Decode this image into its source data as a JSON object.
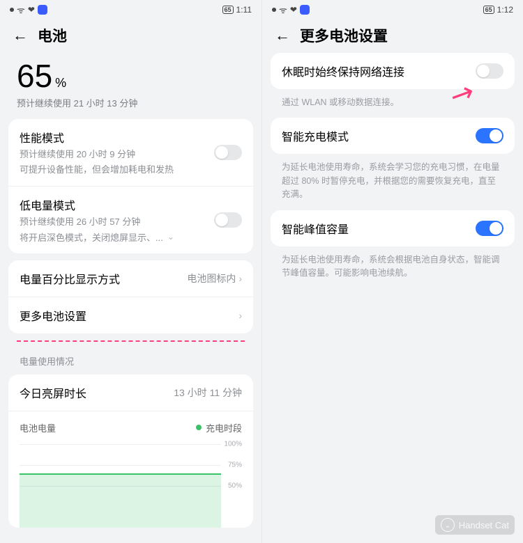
{
  "left": {
    "status": {
      "battery": "65",
      "time": "1:11"
    },
    "header": {
      "title": "电池"
    },
    "hero": {
      "percent": "65",
      "pct_symbol": "%",
      "subtitle": "预计继续使用 21 小时 13 分钟"
    },
    "modes": {
      "perf": {
        "title": "性能模式",
        "sub1": "预计继续使用 20 小时 9 分钟",
        "sub2": "可提升设备性能，但会增加耗电和发热",
        "on": false
      },
      "low": {
        "title": "低电量模式",
        "sub1": "预计继续使用 26 小时 57 分钟",
        "sub2": "将开启深色模式，关闭熄屏显示、...",
        "on": false
      }
    },
    "display": {
      "title": "电量百分比显示方式",
      "value": "电池图标内"
    },
    "more": {
      "title": "更多电池设置"
    },
    "usage_section": "电量使用情况",
    "screen": {
      "title": "今日亮屏时长",
      "value": "13 小时 11 分钟"
    },
    "chart": {
      "label": "电池电量",
      "legend": "充电时段",
      "yticks": [
        "100%",
        "75%",
        "50%"
      ]
    }
  },
  "right": {
    "status": {
      "battery": "65",
      "time": "1:12"
    },
    "header": {
      "title": "更多电池设置"
    },
    "sleep": {
      "title": "休眠时始终保持网络连接",
      "desc": "通过 WLAN 或移动数据连接。",
      "on": false
    },
    "smart_charge": {
      "title": "智能充电模式",
      "desc": "为延长电池使用寿命，系统会学习您的充电习惯，在电量超过 80% 时暂停充电，并根据您的需要恢复充电，直至充满。",
      "on": true
    },
    "smart_peak": {
      "title": "智能峰值容量",
      "desc": "为延长电池使用寿命，系统会根据电池自身状态，智能调节峰值容量。可能影响电池续航。",
      "on": true
    }
  },
  "watermark": "Handset Cat",
  "chart_data": {
    "type": "line",
    "title": "电池电量",
    "ylabel": "%",
    "ylim": [
      0,
      100
    ],
    "yticks": [
      50,
      75,
      100
    ],
    "series": [
      {
        "name": "电池电量",
        "values": [
          65,
          65,
          65,
          65,
          65
        ]
      }
    ],
    "legend": [
      "充电时段"
    ]
  }
}
